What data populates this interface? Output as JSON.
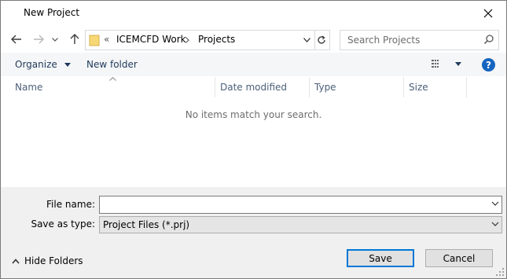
{
  "window": {
    "title": "New Project"
  },
  "nav": {
    "breadcrumb_overflow": "«",
    "breadcrumbs": [
      "ICEMCFD Work",
      "Projects"
    ]
  },
  "search": {
    "placeholder": "Search Projects"
  },
  "toolbar": {
    "organize_label": "Organize",
    "new_folder_label": "New folder"
  },
  "columns": [
    "Name",
    "Date modified",
    "Type",
    "Size"
  ],
  "file_list": {
    "empty_message": "No items match your search."
  },
  "form": {
    "file_name_label": "File name:",
    "file_name_value": "",
    "save_type_label": "Save as type:",
    "save_type_value": "Project Files (*.prj)"
  },
  "footer": {
    "hide_folders_label": "Hide Folders",
    "save_label": "Save",
    "cancel_label": "Cancel"
  },
  "colors": {
    "accent": "#0078d7",
    "help": "#1565c0",
    "command_text": "#1e395b",
    "folder": "#f8d775"
  }
}
